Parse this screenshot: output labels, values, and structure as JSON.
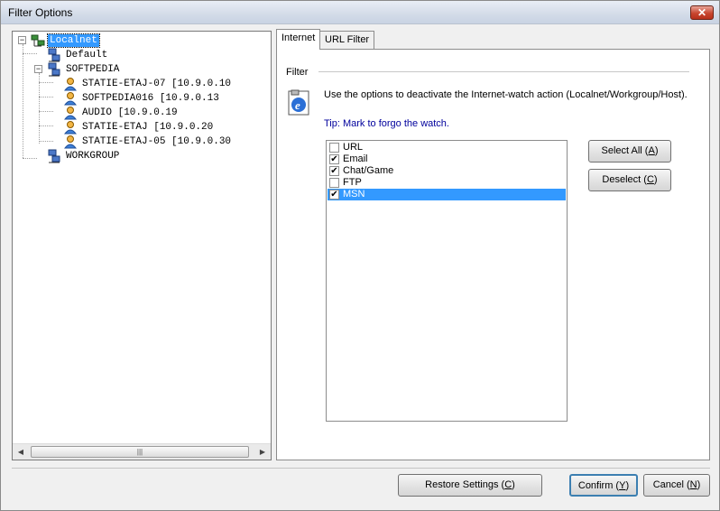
{
  "window": {
    "title": "Filter Options",
    "close_glyph": "✕"
  },
  "tree": {
    "nodes": [
      {
        "label": "Localnet"
      },
      {
        "label": "Default"
      },
      {
        "label": "SOFTPEDIA"
      },
      {
        "label": "STATIE-ETAJ-07 [10.9.0.10"
      },
      {
        "label": "SOFTPEDIA016  [10.9.0.13"
      },
      {
        "label": "AUDIO         [10.9.0.19"
      },
      {
        "label": "STATIE-ETAJ    [10.9.0.20"
      },
      {
        "label": "STATIE-ETAJ-05 [10.9.0.30"
      },
      {
        "label": "WORKGROUP"
      }
    ],
    "expander_collapse": "−",
    "scroll_left": "◀",
    "scroll_right": "▶",
    "scroll_thumb": "|||"
  },
  "tabs": [
    {
      "label": "Internet"
    },
    {
      "label": "URL Filter"
    }
  ],
  "filter": {
    "group_label": "Filter",
    "description": "Use the options to deactivate the Internet-watch action (Localnet/Workgroup/Host).",
    "tip": "Tip: Mark to forgo the watch.",
    "items": [
      {
        "label": "URL",
        "mark": ""
      },
      {
        "label": "Email",
        "mark": "✔"
      },
      {
        "label": "Chat/Game",
        "mark": "✔"
      },
      {
        "label": "FTP",
        "mark": ""
      },
      {
        "label": "MSN",
        "mark": "✔"
      }
    ]
  },
  "buttons": {
    "select_all": {
      "label": "Select All (",
      "key": "A",
      "end": ")"
    },
    "deselect": {
      "label": "Deselect (",
      "key": "C",
      "end": ")"
    },
    "restore": {
      "label": "Restore Settings (",
      "key": "C",
      "end": ")"
    },
    "confirm": {
      "label": "Confirm (",
      "key": "Y",
      "end": ")"
    },
    "cancel": {
      "label": "Cancel (",
      "key": "N",
      "end": ")"
    }
  },
  "colors": {
    "selection": "#3399ff",
    "tip_text": "#00009c"
  }
}
